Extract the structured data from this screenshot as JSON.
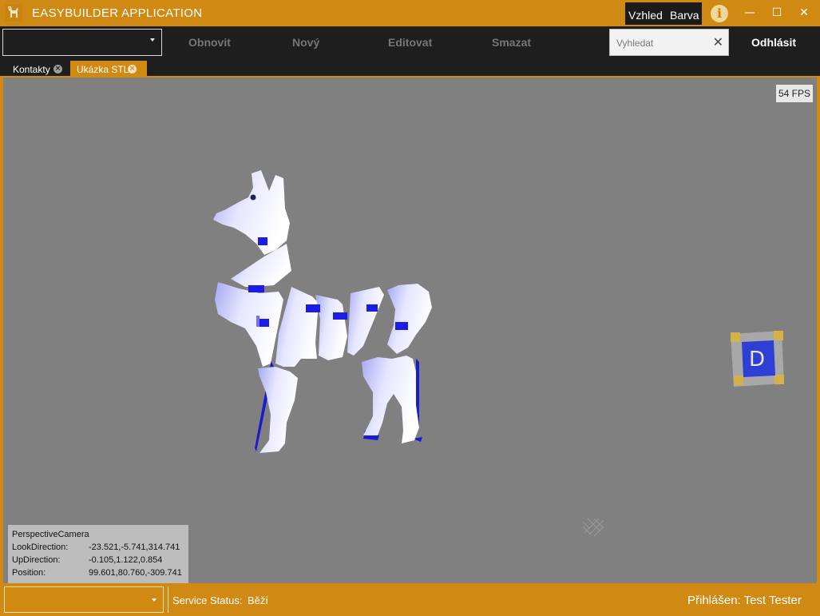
{
  "window": {
    "title": "EASYBUILDER APPLICATION",
    "accent_color": "#d08a14",
    "logo_icon": "llama-logo-icon",
    "theme_menu": {
      "vzhled": "Vzhled",
      "barva": "Barva"
    },
    "info_icon": "i",
    "controls": {
      "minimize": "—",
      "maximize": "☐",
      "close": "✕"
    }
  },
  "toolbar": {
    "combo_value": "",
    "buttons": {
      "refresh": "Obnovit",
      "new": "Nový",
      "edit": "Editovat",
      "delete": "Smazat"
    },
    "search_placeholder": "Vyhledat",
    "search_clear": "✕",
    "logout": "Odhlásit"
  },
  "tabs": [
    {
      "label": "Kontakty",
      "active": false
    },
    {
      "label": "Ukázka STL",
      "active": true
    }
  ],
  "viewport": {
    "fps": "54 FPS",
    "camera": {
      "title": "PerspectiveCamera",
      "rows": [
        {
          "key": "LookDirection:",
          "value": "-23.521,-5.741,314.741"
        },
        {
          "key": "UpDirection:",
          "value": "-0.105,1.122,0.854"
        },
        {
          "key": "Position:",
          "value": "99.601,80.760,-309.741"
        }
      ]
    },
    "view_cube_label": "D",
    "model_icon": "llama-model-icon"
  },
  "statusbar": {
    "combo_value": "",
    "service_status_label": "Service Status:",
    "service_status_value": "Běží",
    "logged_in": "Přihlášen: Test Tester"
  }
}
